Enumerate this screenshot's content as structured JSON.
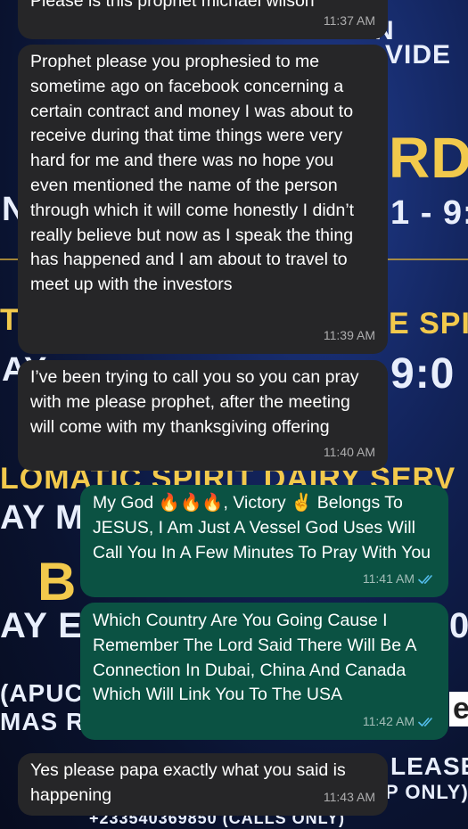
{
  "wallpaper": {
    "lines": [
      "N",
      "VIDE",
      "RD",
      "N",
      "1 - 9:",
      "TI",
      "E SPI",
      "AY",
      "9:0",
      "LOMATIC SPIRIT DAIRY SERV",
      "AY M",
      "B",
      "AY E",
      "0",
      "(APUC",
      "e",
      "MAS R",
      "LEASE",
      "P ONLY)",
      "+233540369850 (CALLS ONLY)"
    ]
  },
  "messages": [
    {
      "direction": "in",
      "text": "Please is this prophet michael wilson",
      "time": "11:37 AM"
    },
    {
      "direction": "in",
      "text": "Prophet please you prophesied to me sometime ago on facebook concerning a certain contract and money I was about to receive during that time things were very hard for me and there was no hope you even mentioned the name of the person through which it will come honestly I didn’t really believe but now as I speak the thing has happened and I am about to travel to meet up with the investors",
      "time": "11:39 AM"
    },
    {
      "direction": "in",
      "text": "I’ve been trying to call you so you can pray with me please prophet, after the meeting will come with my thanksgiving offering",
      "time": "11:40 AM"
    },
    {
      "direction": "out",
      "text": "My God 🔥🔥🔥, Victory ✌️ Belongs To JESUS, I Am Just A Vessel God Uses Will Call You In A Few Minutes To Pray With You",
      "time": "11:41 AM",
      "status": "read"
    },
    {
      "direction": "out",
      "text": "Which Country Are You Going Cause I Remember The Lord Said There Will Be A Connection In Dubai, China And Canada Which Will Link You To The USA",
      "time": "11:42 AM",
      "status": "read"
    },
    {
      "direction": "in",
      "text": "Yes please papa exactly what you said is happening",
      "time": "11:43 AM"
    }
  ],
  "colors": {
    "incoming": "#262628",
    "outgoing": "#0b5243",
    "read_ticks": "#53bdeb"
  }
}
